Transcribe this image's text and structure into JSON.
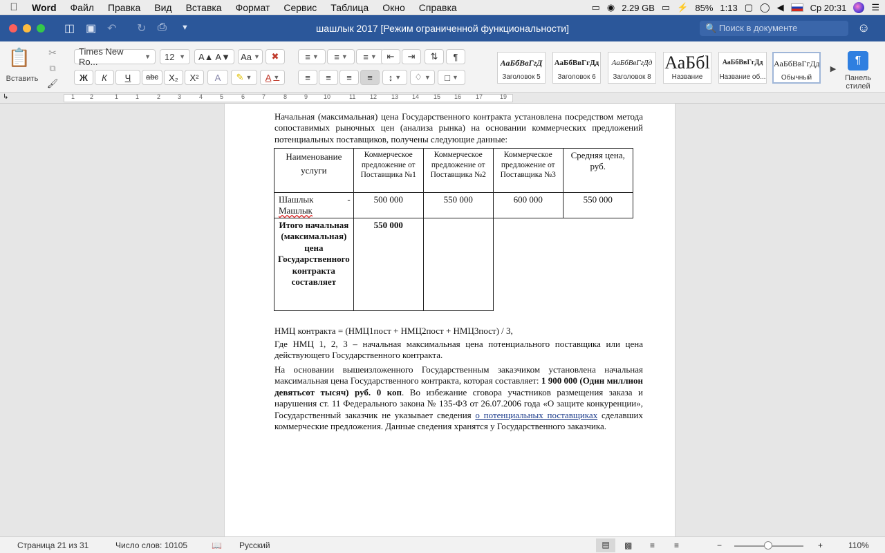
{
  "menubar": {
    "app_name": "Word",
    "items": [
      "Файл",
      "Правка",
      "Вид",
      "Вставка",
      "Формат",
      "Сервис",
      "Таблица",
      "Окно",
      "Справка"
    ],
    "memory": "2.29 GB",
    "battery": "85%",
    "timer": "1:13",
    "clock": "Ср 20:31"
  },
  "titlebar": {
    "title": "шашлык 2017 [Режим ограниченной функциональности]",
    "search_placeholder": "Поиск в документе"
  },
  "ribbon": {
    "paste_label": "Вставить",
    "font_name": "Times New Ro...",
    "font_size": "12",
    "bold": "Ж",
    "italic": "К",
    "underline": "Ч",
    "strike": "abc",
    "subscript": "X₂",
    "superscript": "X²",
    "pilcrow": "¶",
    "styles": [
      {
        "sample": "АаБбВвГгД",
        "name": "Заголовок 5"
      },
      {
        "sample": "АаБбВвГгДд",
        "name": "Заголовок 6"
      },
      {
        "sample": "АаБбВвГгДд",
        "name": "Заголовок 8"
      },
      {
        "sample": "АаБбl",
        "name": "Название"
      },
      {
        "sample": "АаБбВвГгДд",
        "name": "Название об..."
      },
      {
        "sample": "АаБбВвГгДд:",
        "name": "Обычный"
      }
    ],
    "styles_pane_label": "Панель стилей"
  },
  "ruler": {
    "ticks": [
      "1",
      "2",
      "1",
      "1",
      "2",
      "3",
      "4",
      "5",
      "6",
      "7",
      "8",
      "9",
      "10",
      "11",
      "12",
      "13",
      "14",
      "15",
      "16",
      "17",
      "19"
    ]
  },
  "document": {
    "para1": "Начальная (максимальная) цена Государственного контракта установлена посредством метода сопоставимых рыночных цен (анализа рынка) на основании коммерческих предложений потенциальных поставщиков, получены следующие данные:",
    "table": {
      "headers": [
        "Наименование услуги",
        "Коммерческое предложение от Поставщика №1",
        "Коммерческое предложение от Поставщика №2",
        "Коммерческое предложение от Поставщика №3",
        "Средняя цена, руб."
      ],
      "row1": {
        "name_part1": "Шашлык",
        "name_dash": "-",
        "name_part2": "Машлык",
        "v1": "500 000",
        "v2": "550 000",
        "v3": "600 000",
        "avg": "550 000"
      },
      "total_label": "Итого начальная (максимальная) цена Государственного контракта составляет",
      "total_value": "550 000"
    },
    "formula": "НМЦ контракта = (НМЦ1пост + НМЦ2пост + НМЦ3пост) / 3,",
    "para_where": "Где НМЦ 1, 2, 3 – начальная максимальная цена потенциального поставщика или цена действующего Государственного контракта.",
    "para_final_a": "На основании вышеизложенного Государственным заказчиком установлена начальная максимальная цена Государственного контракта, которая составляет: ",
    "para_final_bold": "1 900 000 (Один миллион девятьсот тысяч) руб. 0 коп",
    "para_final_b": ". Во избежание сговора участников размещения заказа и нарушения ст. 11 Федерального закона № 135-ФЗ от 26.07.2006 года «О защите конкуренции», Государственный заказчик не указывает сведения ",
    "para_final_link": "о потенциальных поставщиках",
    "para_final_c": " сделавших коммерческие предложения. Данные сведения хранятся у Государственного заказчика."
  },
  "statusbar": {
    "page": "Страница 21 из 31",
    "words": "Число слов: 10105",
    "language": "Русский",
    "zoom": "110%"
  }
}
